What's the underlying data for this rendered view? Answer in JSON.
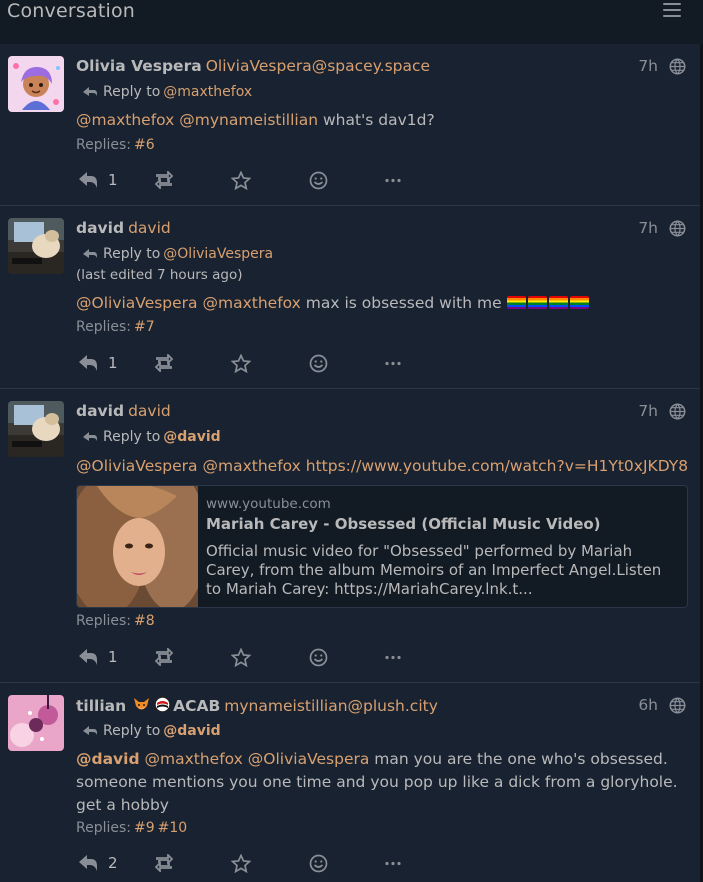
{
  "header": {
    "title": "Conversation",
    "menu_icon": "hamburger-menu-icon"
  },
  "colors": {
    "background": "#0f141a",
    "panel": "#182230",
    "accent": "#d8a070",
    "text": "#b9b9ba",
    "muted": "#8a8f97"
  },
  "posts": [
    {
      "display_name": "Olivia Vespera",
      "account": "OliviaVespera@spacey.space",
      "time": "7h",
      "reply_label": "Reply to",
      "reply_to": "@maxthefox",
      "content": {
        "m1": "@maxthefox",
        "m2": "@mynameistillian",
        "text": " what's dav1d?"
      },
      "replies_label": "Replies:",
      "replies": [
        "#6"
      ],
      "reply_count": "1"
    },
    {
      "display_name": "david",
      "account": "david",
      "time": "7h",
      "reply_label": "Reply to",
      "reply_to": "@OliviaVespera",
      "edited": "(last edited 7 hours ago)",
      "content": {
        "m1": "@OliviaVespera",
        "m2": "@maxthefox",
        "text": " max is obsessed with me "
      },
      "flag_emoji": "rainbow-flag-emoji",
      "replies_label": "Replies:",
      "replies": [
        "#7"
      ],
      "reply_count": "1"
    },
    {
      "display_name": "david",
      "account": "david",
      "time": "7h",
      "reply_label": "Reply to",
      "reply_to": "@david",
      "content": {
        "m1": "@OliviaVespera",
        "m2": "@maxthefox",
        "link": "https://www.youtube.com/watch?v=H1Yt0xJKDY8"
      },
      "card": {
        "host": "www.youtube.com",
        "title": "Mariah Carey - Obsessed (Official Music Video)",
        "description": "Official music video for \"Obsessed\" performed by Mariah Carey, from the album Memoirs of an Imperfect Angel.Listen to Mariah Carey: https://MariahCarey.lnk.t..."
      },
      "replies_label": "Replies:",
      "replies": [
        "#8"
      ],
      "reply_count": "1"
    },
    {
      "display_name": "tillian",
      "display_name_suffix": "ACAB",
      "account": "mynameistillian@plush.city",
      "time": "6h",
      "reply_label": "Reply to",
      "reply_to": "@david",
      "content": {
        "m1": "@david",
        "m2": "@maxthefox",
        "m3": "@OliviaVespera",
        "text": " man you are the one who's obsessed. someone mentions you one time and you pop up like a dick from a gloryhole. get a hobby"
      },
      "replies_label": "Replies:",
      "replies": [
        "#9",
        "#10"
      ],
      "reply_count": "2"
    }
  ],
  "action_icons": [
    "reply-icon",
    "repeat-icon",
    "favorite-star-icon",
    "emoji-reaction-icon",
    "more-options-icon"
  ]
}
